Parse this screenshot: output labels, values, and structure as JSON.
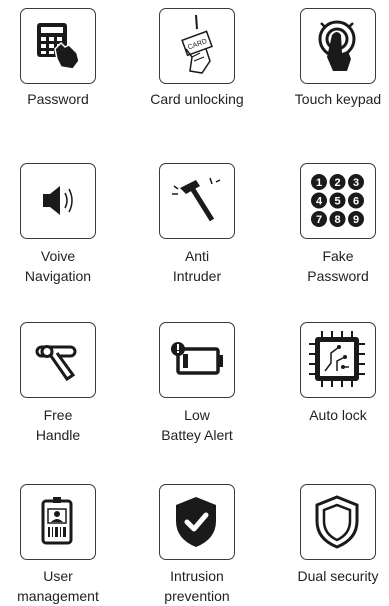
{
  "features": [
    {
      "id": "password",
      "icon": "keypad-hand-icon",
      "lines": [
        "Password"
      ]
    },
    {
      "id": "card",
      "icon": "card-hand-icon",
      "lines": [
        "Card unlocking"
      ]
    },
    {
      "id": "touch",
      "icon": "touch-keypad-icon",
      "lines": [
        "Touch keypad"
      ]
    },
    {
      "id": "voice",
      "icon": "speaker-icon",
      "lines": [
        "Voive",
        "Navigation"
      ]
    },
    {
      "id": "anti",
      "icon": "hammer-icon",
      "lines": [
        "Anti",
        "Intruder"
      ]
    },
    {
      "id": "fake",
      "icon": "number-keypad-icon",
      "lines": [
        "Fake",
        "Password"
      ]
    },
    {
      "id": "handle",
      "icon": "door-handle-icon",
      "lines": [
        "Free",
        "Handle"
      ]
    },
    {
      "id": "battery",
      "icon": "low-battery-icon",
      "lines": [
        "Low",
        "Battey Alert"
      ]
    },
    {
      "id": "autolock",
      "icon": "chip-icon",
      "lines": [
        "Auto lock"
      ]
    },
    {
      "id": "user",
      "icon": "id-badge-icon",
      "lines": [
        "User",
        "management"
      ]
    },
    {
      "id": "intrusion",
      "icon": "shield-check-icon",
      "lines": [
        "Intrusion",
        "prevention"
      ]
    },
    {
      "id": "dual",
      "icon": "double-shield-icon",
      "lines": [
        "Dual security"
      ]
    }
  ],
  "keypad_digits": [
    "1",
    "2",
    "3",
    "4",
    "5",
    "6",
    "7",
    "8",
    "9"
  ],
  "card_text": "CARD",
  "colors": {
    "ink": "#1a1a1a",
    "border": "#3a3a3a",
    "text": "#222222"
  }
}
